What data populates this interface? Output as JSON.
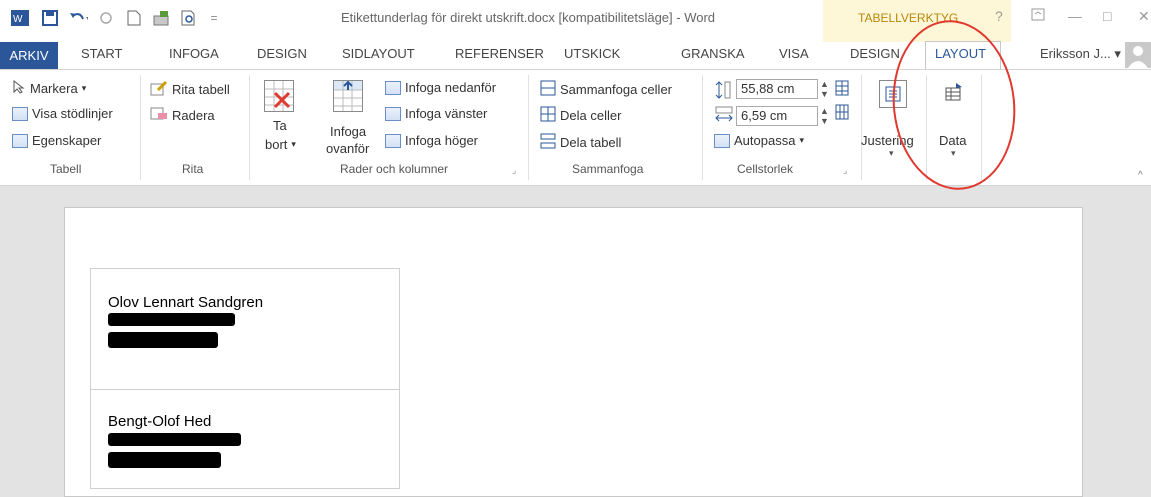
{
  "window": {
    "title": "Etikettunderlag för direkt utskrift.docx [kompatibilitetsläge] - Word",
    "context_label": "TABELLVERKTYG",
    "help": "?",
    "minimize": "—",
    "restore": "□",
    "close": "✕"
  },
  "tabs": {
    "file": "ARKIV",
    "start": "START",
    "insert": "INFOGA",
    "design": "DESIGN",
    "page_layout": "SIDLAYOUT",
    "references": "REFERENSER",
    "mailings": "UTSKICK",
    "review": "GRANSKA",
    "view": "VISA",
    "table_design": "DESIGN",
    "table_layout": "LAYOUT"
  },
  "user": {
    "name": "Eriksson J...",
    "dropdown": "▾"
  },
  "ribbon": {
    "tabell": {
      "select": "Markera",
      "gridlines": "Visa stödlinjer",
      "properties": "Egenskaper",
      "label": "Tabell"
    },
    "rita": {
      "draw_table": "Rita tabell",
      "eraser": "Radera",
      "label": "Rita"
    },
    "rows_cols": {
      "delete_line1": "Ta",
      "delete_line2": "bort",
      "insert_above_line1": "Infoga",
      "insert_above_line2": "ovanför",
      "insert_below": "Infoga nedanför",
      "insert_left": "Infoga vänster",
      "insert_right": "Infoga höger",
      "label": "Rader och kolumner"
    },
    "merge": {
      "merge_cells": "Sammanfoga celler",
      "split_cells": "Dela celler",
      "split_table": "Dela tabell",
      "label": "Sammanfoga"
    },
    "cell_size": {
      "height": "55,88 cm",
      "width": "6,59 cm",
      "autofit": "Autopassa",
      "label": "Cellstorlek"
    },
    "alignment": {
      "label": "Justering"
    },
    "data": {
      "label": "Data"
    }
  },
  "document": {
    "label1_name": "Olov Lennart Sandgren",
    "label2_name": "Bengt-Olof Hed"
  },
  "colors": {
    "accent": "#2b579a",
    "annotation": "#e0392f",
    "context": "#fdf7d7"
  }
}
